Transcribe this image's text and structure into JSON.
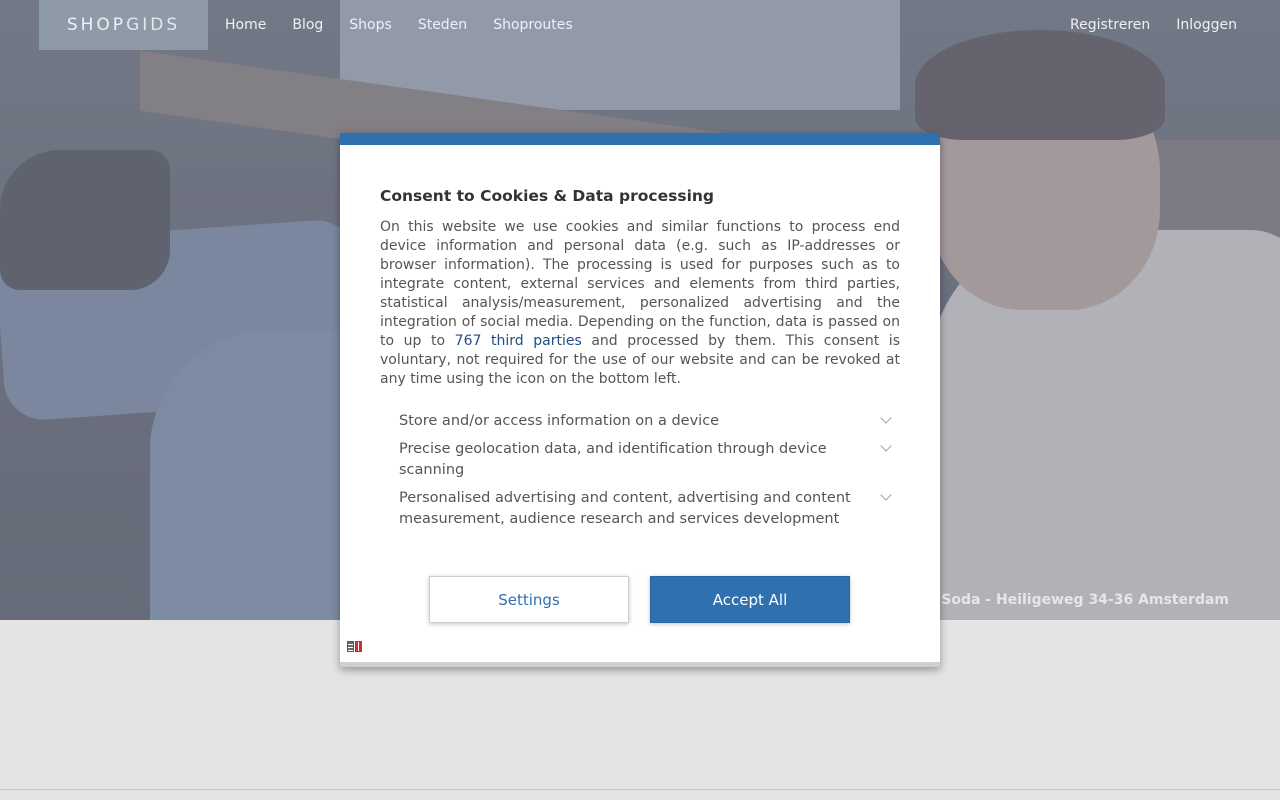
{
  "nav": {
    "logo_bold": "SHOP",
    "logo_light": "GIDS",
    "links": [
      "Home",
      "Blog",
      "Shops",
      "Steden",
      "Shoproutes"
    ],
    "right_links": [
      "Registreren",
      "Inloggen"
    ]
  },
  "hero": {
    "caption": "Soda - Heiligeweg 34-36 Amsterdam"
  },
  "consent": {
    "title": "Consent to Cookies & Data processing",
    "body_before_link": "On this website we use cookies and similar functions to process end device information and personal data (e.g. such as IP-addresses or browser information). The processing is used for purposes such as to integrate content, external services and elements from third parties, statistical analysis/measurement, personalized advertising and the integration of social media. Depending on the function, data is passed on to up to ",
    "third_parties_link": "767 third parties",
    "body_after_link": " and processed by them. This consent is voluntary, not required for the use of our website and can be revoked at any time using the icon on the bottom left.",
    "purposes": [
      "Store and/or access information on a device",
      "Precise geolocation data, and identification through device scanning",
      "Personalised advertising and content, advertising and content measurement, audience research and services development"
    ],
    "settings_label": "Settings",
    "accept_label": "Accept All",
    "language_icon": "language-flag-icon"
  },
  "colors": {
    "accent": "#2f70ae",
    "page_bg": "#e4e4e6"
  }
}
